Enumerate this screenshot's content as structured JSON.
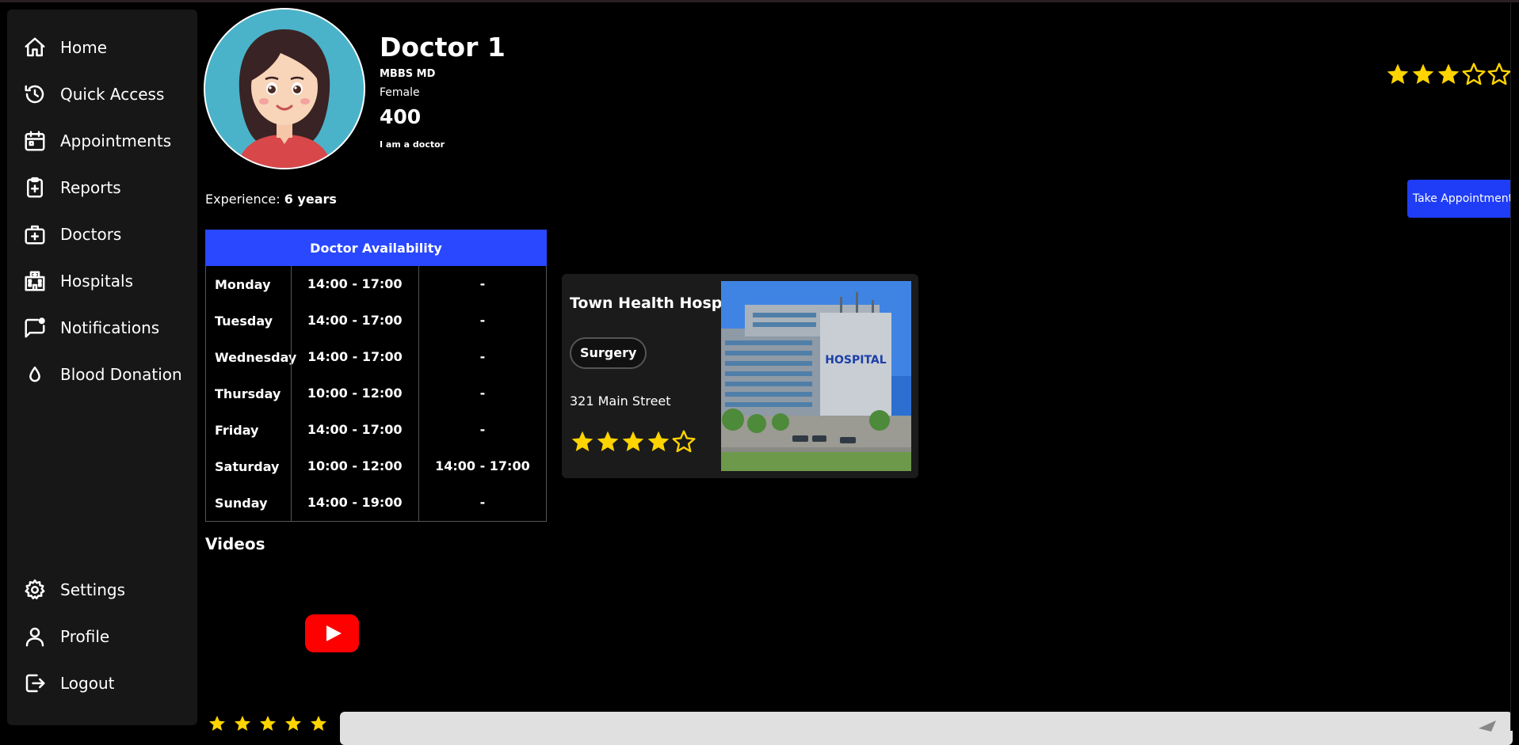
{
  "sidebar": {
    "items": [
      {
        "label": "Home",
        "icon": "home-icon"
      },
      {
        "label": "Quick Access",
        "icon": "history-icon"
      },
      {
        "label": "Appointments",
        "icon": "calendar-icon"
      },
      {
        "label": "Reports",
        "icon": "clipboard-icon"
      },
      {
        "label": "Doctors",
        "icon": "medical-bag-icon"
      },
      {
        "label": "Hospitals",
        "icon": "hospital-building-icon"
      },
      {
        "label": "Notifications",
        "icon": "notification-icon"
      },
      {
        "label": "Blood Donation",
        "icon": "blood-drop-icon"
      }
    ],
    "bottom_items": [
      {
        "label": "Settings",
        "icon": "gear-icon"
      },
      {
        "label": "Profile",
        "icon": "user-icon"
      },
      {
        "label": "Logout",
        "icon": "logout-icon"
      }
    ]
  },
  "doctor": {
    "name": "Doctor 1",
    "degree": "MBBS MD",
    "gender": "Female",
    "fee": "400",
    "bio": "I am a doctor",
    "rating": 3,
    "rating_max": 5,
    "experience_label": "Experience:",
    "experience_value": "6 years"
  },
  "actions": {
    "take_appointment": "Take Appointment"
  },
  "availability": {
    "title": "Doctor Availability",
    "rows": [
      {
        "day": "Monday",
        "slot1": "14:00 - 17:00",
        "slot2": "-"
      },
      {
        "day": "Tuesday",
        "slot1": "14:00 - 17:00",
        "slot2": "-"
      },
      {
        "day": "Wednesday",
        "slot1": "14:00 - 17:00",
        "slot2": "-"
      },
      {
        "day": "Thursday",
        "slot1": "10:00 - 12:00",
        "slot2": "-"
      },
      {
        "day": "Friday",
        "slot1": "14:00 - 17:00",
        "slot2": "-"
      },
      {
        "day": "Saturday",
        "slot1": "10:00 - 12:00",
        "slot2": "14:00 - 17:00"
      },
      {
        "day": "Sunday",
        "slot1": "14:00 - 19:00",
        "slot2": "-"
      }
    ]
  },
  "hospital": {
    "name": "Town Health Hospital",
    "department": "Surgery",
    "address": "321 Main Street",
    "rating": 4,
    "rating_max": 5,
    "image_sign": "HOSPITAL"
  },
  "videos": {
    "title": "Videos"
  },
  "review": {
    "rating_max": 5
  },
  "colors": {
    "accent": "#2948ff",
    "star": "#ffd400",
    "sidebar_bg": "#171717",
    "card_bg": "#1b1b1b"
  }
}
